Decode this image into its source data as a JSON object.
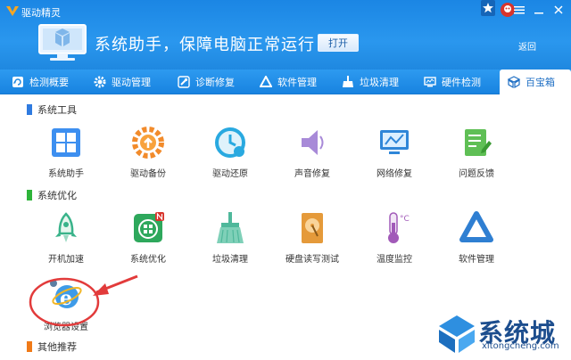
{
  "app": {
    "title": "驱动精灵"
  },
  "hero": {
    "text": "系统助手，保障电脑正常运行",
    "open_label": "打开",
    "back_label": "返回"
  },
  "tabs": [
    {
      "label": "检测概要",
      "icon": "refresh-icon"
    },
    {
      "label": "驱动管理",
      "icon": "gear-icon"
    },
    {
      "label": "诊断修复",
      "icon": "wrench-icon"
    },
    {
      "label": "软件管理",
      "icon": "triangle-icon"
    },
    {
      "label": "垃圾清理",
      "icon": "broom-icon"
    },
    {
      "label": "硬件检测",
      "icon": "monitor-icon"
    },
    {
      "label": "百宝箱",
      "icon": "box-icon",
      "active": true
    }
  ],
  "sections": {
    "system_tools": {
      "title": "系统工具",
      "color": "#2f7be0",
      "items": [
        "系统助手",
        "驱动备份",
        "驱动还原",
        "声音修复",
        "网络修复",
        "问题反馈"
      ]
    },
    "system_opt": {
      "title": "系统优化",
      "color": "#2eb43a",
      "items": [
        "开机加速",
        "系统优化",
        "垃圾清理",
        "硬盘读写测试",
        "温度监控",
        "软件管理"
      ],
      "extra": "浏览器设置"
    },
    "other": {
      "title": "其他推荐",
      "color": "#f07a18"
    }
  },
  "watermark": {
    "brand": "系统城",
    "url": "xitongcheng.com"
  }
}
